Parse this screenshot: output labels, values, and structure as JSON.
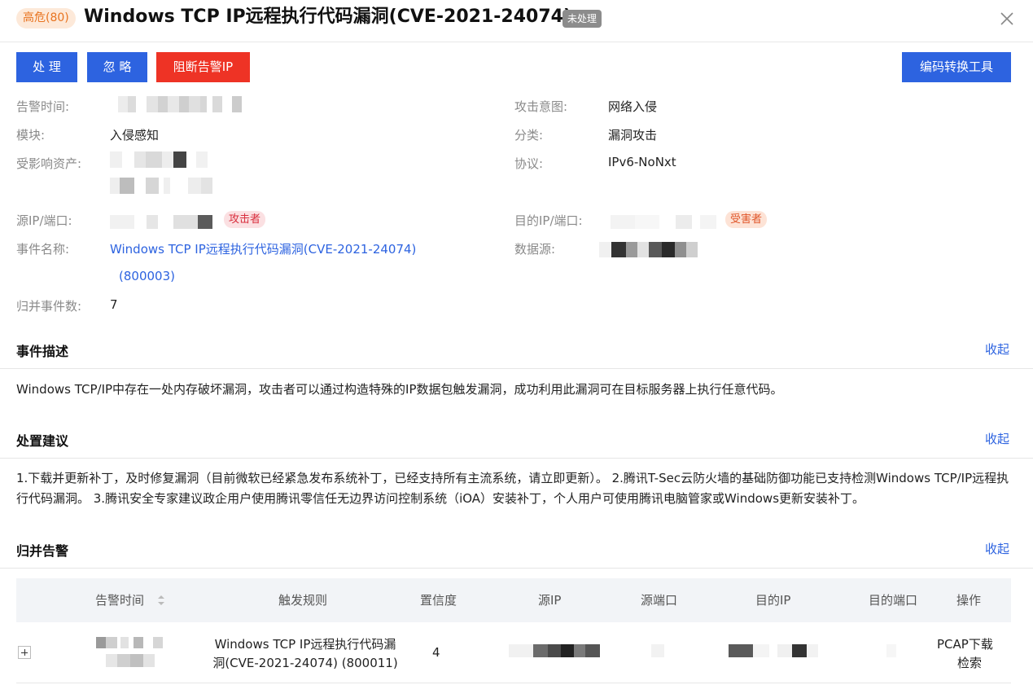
{
  "header": {
    "severity": "高危(80)",
    "title": "Windows TCP IP远程执行代码漏洞(CVE-2021-24074)",
    "status": "未处理"
  },
  "toolbar": {
    "handle": "处 理",
    "ignore": "忽 略",
    "block_ip": "阻断告警IP",
    "encode_tool": "编码转换工具"
  },
  "details": {
    "alert_time_label": "告警时间:",
    "module_label": "模块:",
    "module_value": "入侵感知",
    "asset_label": "受影响资产:",
    "src_label": "源IP/端口:",
    "attacker_tag": "攻击者",
    "event_name_label": "事件名称:",
    "event_name_value": "Windows TCP IP远程执行代码漏洞(CVE-2021-24074)",
    "event_id": "(800003)",
    "merged_count_label": "归并事件数:",
    "merged_count_value": "7",
    "intent_label": "攻击意图:",
    "intent_value": "网络入侵",
    "category_label": "分类:",
    "category_value": "漏洞攻击",
    "protocol_label": "协议:",
    "protocol_value": "IPv6-NoNxt",
    "dst_label": "目的IP/端口:",
    "victim_tag": "受害者",
    "datasource_label": "数据源:"
  },
  "description": {
    "title": "事件描述",
    "collapse": "收起",
    "text": "Windows TCP/IP中存在一处内存破坏漏洞，攻击者可以通过构造特殊的IP数据包触发漏洞，成功利用此漏洞可在目标服务器上执行任意代码。"
  },
  "advice": {
    "title": "处置建议",
    "collapse": "收起",
    "text": "1.下载并更新补丁，及时修复漏洞（目前微软已经紧急发布系统补丁，已经支持所有主流系统，请立即更新）。 2.腾讯T-Sec云防火墙的基础防御功能已支持检测Windows TCP/IP远程执行代码漏洞。 3.腾讯安全专家建议政企用户使用腾讯零信任无边界访问控制系统（iOA）安装补丁，个人用户可使用腾讯电脑管家或Windows更新安装补丁。"
  },
  "merged": {
    "title": "归并告警",
    "collapse": "收起",
    "columns": [
      "告警时间",
      "触发规则",
      "置信度",
      "源IP",
      "源端口",
      "目的IP",
      "目的端口",
      "操作"
    ],
    "rows": [
      {
        "rule_line1": "Windows TCP IP远程执行代码漏",
        "rule_line2": "洞(CVE-2021-24074) (800011)",
        "confidence": "4",
        "action_pcap": "PCAP下载",
        "action_search": "检索"
      }
    ]
  },
  "icons": {
    "close": "close-icon",
    "sort": "sort-icon",
    "expand": "plus-icon"
  },
  "colors": {
    "primary": "#2d63e0",
    "danger": "#ee3325",
    "severity_bg": "#fde9d9",
    "severity_text": "#e8731f"
  }
}
